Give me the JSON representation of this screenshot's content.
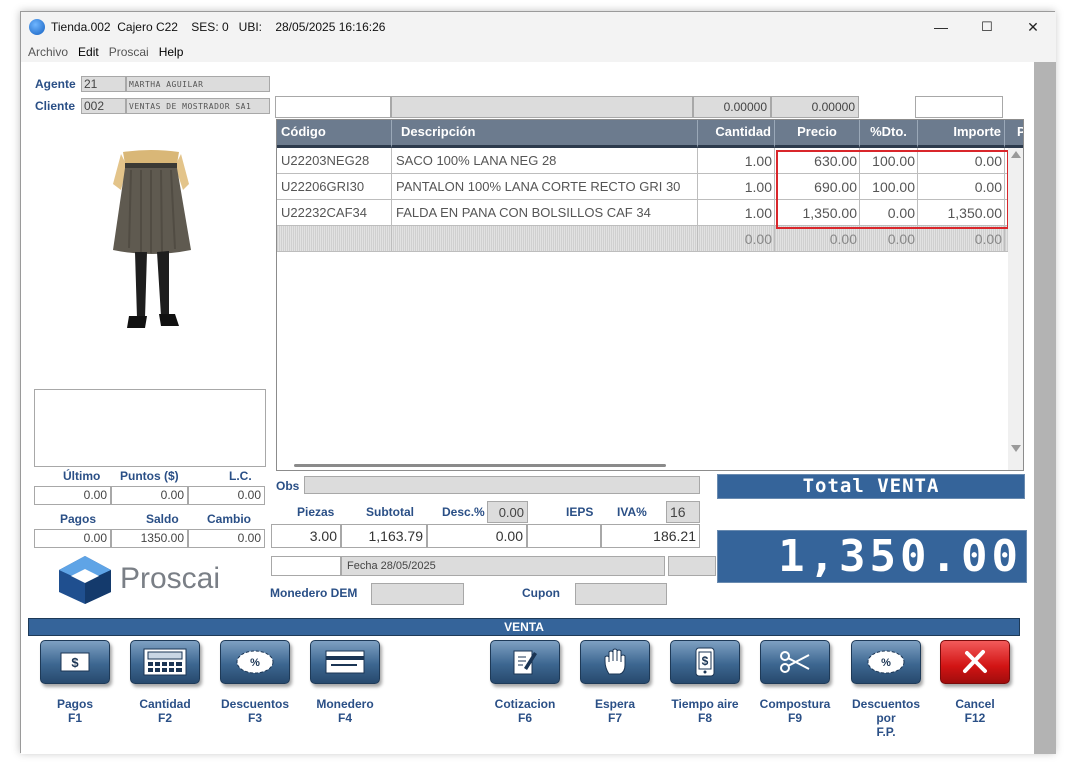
{
  "window": {
    "title": "Tienda.002  Cajero C22    SES: 0   UBI:    28/05/2025 16:16:26",
    "minimize": "—",
    "maximize": "☐",
    "close": "✕"
  },
  "menu": [
    "Archivo",
    "Edit",
    "Proscai",
    "Help"
  ],
  "header": {
    "agente_label": "Agente",
    "agente_code": "21",
    "agente_name": "MARTHA AGUILAR",
    "cliente_label": "Cliente",
    "cliente_code": "002",
    "cliente_name": "VENTAS DE MOSTRADOR SA1"
  },
  "top_inputs": {
    "field_a": "",
    "field_b": "",
    "total_qty": "0.00000",
    "total_price": "0.00000",
    "field_c": ""
  },
  "grid": {
    "columns": [
      "Código",
      "Descripción",
      "Cantidad",
      "Precio",
      "%Dto.",
      "Importe",
      "P"
    ],
    "rows": [
      {
        "codigo": "U22203NEG28",
        "descripcion": "SACO 100% LANA NEG 28",
        "cantidad": "1.00",
        "precio": "630.00",
        "dto": "100.00",
        "importe": "0.00"
      },
      {
        "codigo": "U22206GRI30",
        "descripcion": "PANTALON 100% LANA  CORTE RECTO GRI 30",
        "cantidad": "1.00",
        "precio": "690.00",
        "dto": "100.00",
        "importe": "0.00"
      },
      {
        "codigo": "U22232CAF34",
        "descripcion": "FALDA EN PANA CON BOLSILLOS CAF 34",
        "cantidad": "1.00",
        "precio": "1,350.00",
        "dto": "0.00",
        "importe": "1,350.00"
      }
    ],
    "empty_row": {
      "cantidad": "0.00",
      "precio": "0.00",
      "dto": "0.00",
      "importe": "0.00"
    }
  },
  "customer_stats": {
    "ultimo_label": "Último",
    "puntos_label": "Puntos ($)",
    "lc_label": "L.C.",
    "ultimo": "0.00",
    "puntos": "0.00",
    "lc": "0.00",
    "pagos_label": "Pagos",
    "saldo_label": "Saldo",
    "cambio_label": "Cambio",
    "pagos": "0.00",
    "saldo": "1350.00",
    "cambio": "0.00"
  },
  "totals": {
    "obs_label": "Obs",
    "obs": "",
    "piezas_label": "Piezas",
    "subtotal_label": "Subtotal",
    "desc_label": "Desc.%",
    "desc_pct": "0.00",
    "ieps_label": "IEPS",
    "iva_label": "IVA%",
    "iva_pct": "16",
    "piezas": "3.00",
    "subtotal": "1,163.79",
    "desc_amount": "0.00",
    "ieps": "",
    "iva": "186.21",
    "fecha": "Fecha 28/05/2025",
    "monedero_label": "Monedero DEM",
    "cupon_label": "Cupon",
    "total_venta_label": "Total VENTA",
    "total_venta": "1,350.00"
  },
  "logo": {
    "text": "Proscai"
  },
  "mode_bar": "VENTA",
  "buttons": [
    {
      "label": "Pagos",
      "key": "F1",
      "icon": "cash-icon"
    },
    {
      "label": "Cantidad",
      "key": "F2",
      "icon": "calculator-icon"
    },
    {
      "label": "Descuentos",
      "key": "F3",
      "icon": "discount-icon"
    },
    {
      "label": "Monedero",
      "key": "F4",
      "icon": "card-icon"
    },
    {
      "label": "Cotizacion",
      "key": "F6",
      "icon": "quote-icon"
    },
    {
      "label": "Espera",
      "key": "F7",
      "icon": "hand-icon"
    },
    {
      "label": "Tiempo aire",
      "key": "F8",
      "icon": "phone-icon"
    },
    {
      "label": "Compostura",
      "key": "F9",
      "icon": "scissors-icon"
    },
    {
      "label": "Descuentos por",
      "key": "F.P.",
      "icon": "discount-icon"
    },
    {
      "label": "Cancel",
      "key": "F12",
      "icon": "cancel-icon"
    }
  ],
  "colors": {
    "accent": "#2a4f86",
    "bar": "#35649a",
    "highlight": "#d9262b"
  }
}
